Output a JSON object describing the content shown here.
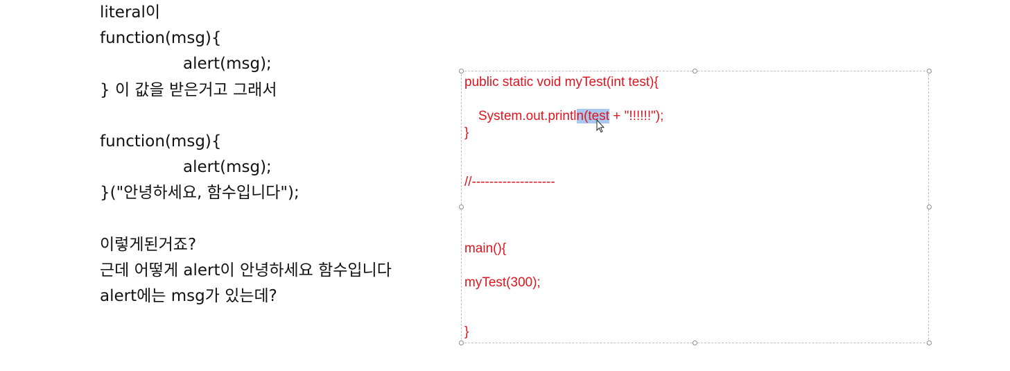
{
  "notes": {
    "lines": [
      "literal이",
      "function(msg){",
      "alert(msg);",
      "} 이 값을 받은거고 그래서",
      "function(msg){",
      "alert(msg);",
      "}(\"안녕하세요, 함수입니다\");",
      "이렇게된거죠?",
      "근데 어떻게 alert이 안녕하세요 함수입니다",
      "alert에는 msg가 있는데?"
    ]
  },
  "code_box": {
    "line1": "public static void myTest(int test){",
    "line2_before": "System.out.printl",
    "line2_selected": "n(test",
    "line2_after": " + \"!!!!!!\");",
    "line3": "}",
    "line4": "//-------------------",
    "line5": "main(){",
    "line6": "myTest(300);",
    "line7": "}"
  },
  "colors": {
    "code_text": "#e0141e",
    "selection": "#a9c8ef",
    "notes_text": "#111111"
  },
  "icons": {
    "cursor": "arrow-cursor-icon"
  }
}
